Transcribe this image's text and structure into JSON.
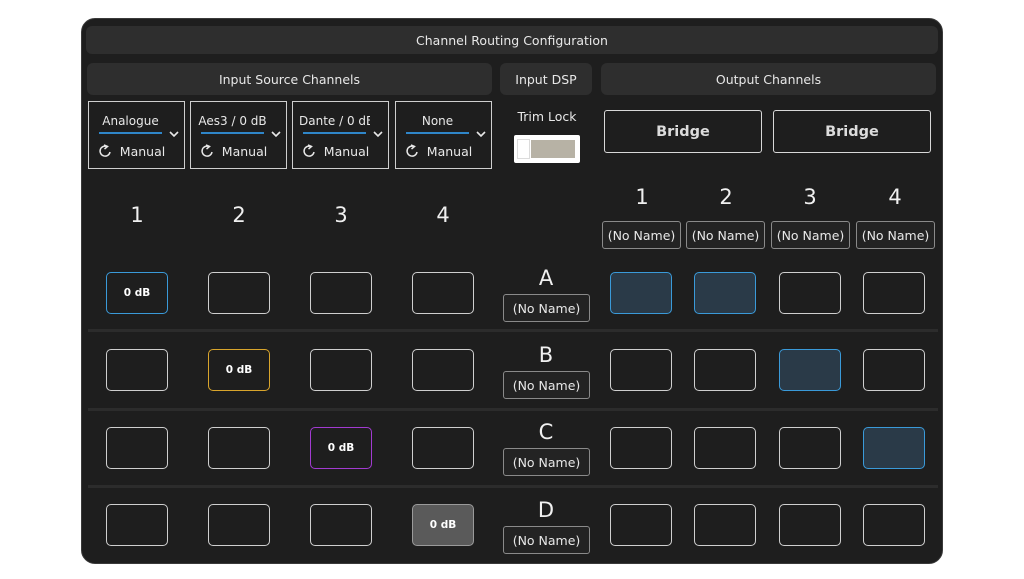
{
  "title": "Channel Routing Configuration",
  "sections": {
    "input_source": "Input Source Channels",
    "input_dsp": "Input DSP",
    "output": "Output Channels"
  },
  "sources": [
    {
      "value": "Analogue",
      "mode": "Manual"
    },
    {
      "value": "Aes3 / 0 dB",
      "mode": "Manual"
    },
    {
      "value": "Dante / 0 dB",
      "mode": "Manual"
    },
    {
      "value": "None",
      "mode": "Manual"
    }
  ],
  "trim_lock": {
    "label": "Trim Lock",
    "state": "off"
  },
  "bridges": [
    "Bridge",
    "Bridge"
  ],
  "input_channels": [
    "1",
    "2",
    "3",
    "4"
  ],
  "output_channels": [
    {
      "number": "1",
      "name": "(No Name)"
    },
    {
      "number": "2",
      "name": "(No Name)"
    },
    {
      "number": "3",
      "name": "(No Name)"
    },
    {
      "number": "4",
      "name": "(No Name)"
    }
  ],
  "rows": [
    {
      "letter": "A",
      "name": "(No Name)",
      "inputs": [
        {
          "label": "0 dB",
          "style": "blue"
        },
        {
          "label": "",
          "style": "empty"
        },
        {
          "label": "",
          "style": "empty"
        },
        {
          "label": "",
          "style": "empty"
        }
      ],
      "outputs": [
        "selected",
        "selected",
        "empty",
        "empty"
      ]
    },
    {
      "letter": "B",
      "name": "(No Name)",
      "inputs": [
        {
          "label": "",
          "style": "empty"
        },
        {
          "label": "0 dB",
          "style": "amber"
        },
        {
          "label": "",
          "style": "empty"
        },
        {
          "label": "",
          "style": "empty"
        }
      ],
      "outputs": [
        "empty",
        "empty",
        "selected",
        "empty"
      ]
    },
    {
      "letter": "C",
      "name": "(No Name)",
      "inputs": [
        {
          "label": "",
          "style": "empty"
        },
        {
          "label": "",
          "style": "empty"
        },
        {
          "label": "0 dB",
          "style": "purple"
        },
        {
          "label": "",
          "style": "empty"
        }
      ],
      "outputs": [
        "empty",
        "empty",
        "empty",
        "selected"
      ]
    },
    {
      "letter": "D",
      "name": "(No Name)",
      "inputs": [
        {
          "label": "",
          "style": "empty"
        },
        {
          "label": "",
          "style": "empty"
        },
        {
          "label": "",
          "style": "empty"
        },
        {
          "label": "0 dB",
          "style": "gray"
        }
      ],
      "outputs": [
        "empty",
        "empty",
        "empty",
        "empty"
      ]
    }
  ],
  "colors": {
    "accent_blue": "#3a9ad9",
    "amber": "#d9a52c",
    "purple": "#a23bd1",
    "gray": "#5a5a5a",
    "background": "#1e1e1e"
  }
}
